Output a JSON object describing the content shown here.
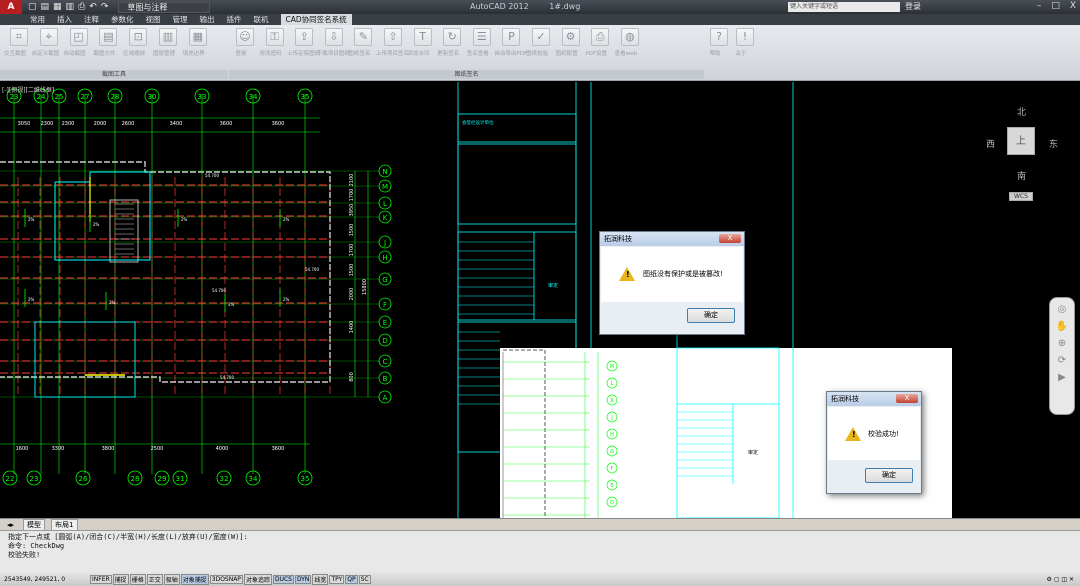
{
  "titlebar": {
    "app_icon": "A",
    "workspace": "草图与注释",
    "app_name": "AutoCAD 2012",
    "file_name": "1#.dwg",
    "search_placeholder": "键入关键字或短语",
    "login_label": "登录",
    "minimize_label": "–",
    "maximize_label": "□",
    "close_label": "X"
  },
  "menu": {
    "items": [
      "常用",
      "插入",
      "注释",
      "参数化",
      "视图",
      "管理",
      "输出",
      "插件",
      "联机",
      "CAD协同签名系统"
    ],
    "active_index": 9
  },
  "ribbon": {
    "tools": [
      {
        "label": "交互截图",
        "icon": "crop-icon"
      },
      {
        "label": "自定义截图",
        "icon": "crop-custom-icon"
      },
      {
        "label": "自动截图",
        "icon": "auto-crop-icon"
      },
      {
        "label": "截图文件",
        "icon": "file-icon"
      },
      {
        "label": "区域缩放",
        "icon": "zoom-icon"
      },
      {
        "label": "图层管理",
        "icon": "layers-icon"
      },
      {
        "label": "填充边界",
        "icon": "hatch-icon"
      },
      {
        "label": "登录",
        "icon": "user-icon"
      },
      {
        "label": "修改密码",
        "icon": "key-icon"
      },
      {
        "label": "上传定稿图纸",
        "icon": "upload-icon"
      },
      {
        "label": "下载项目图纸",
        "icon": "download-icon"
      },
      {
        "label": "图纸签名",
        "icon": "sign-icon"
      },
      {
        "label": "上传项目签名",
        "icon": "upload-sign-icon"
      },
      {
        "label": "添加水印",
        "icon": "watermark-icon"
      },
      {
        "label": "更新签名",
        "icon": "refresh-icon"
      },
      {
        "label": "签名查看",
        "icon": "view-sign-icon"
      },
      {
        "label": "自动导出PDF",
        "icon": "pdf-icon"
      },
      {
        "label": "图纸校验",
        "icon": "check-icon"
      },
      {
        "label": "图纸配置",
        "icon": "config-icon"
      },
      {
        "label": "PDF设置",
        "icon": "printer-icon"
      },
      {
        "label": "查看web",
        "icon": "web-icon"
      },
      {
        "label": "帮助",
        "icon": "help-icon"
      },
      {
        "label": "关于",
        "icon": "about-icon"
      }
    ],
    "panels": [
      "截图工具",
      "图纸签名"
    ]
  },
  "viewport": {
    "label": "[-][俯视][二维线框]",
    "compass": {
      "north": "北",
      "south": "南",
      "east": "东",
      "west": "西",
      "center": "上",
      "ucs": "WCS"
    },
    "top_axes": [
      "23",
      "24",
      "25",
      "27",
      "28",
      "30",
      "33",
      "34",
      "35"
    ],
    "top_dims": [
      "3050",
      "2300",
      "2300",
      "2000",
      "2600",
      "3400",
      "3600",
      "3600"
    ],
    "bottom_axes": [
      "22",
      "23",
      "26",
      "28",
      "29",
      "31",
      "32",
      "34",
      "35"
    ],
    "bottom_dims": [
      "1600",
      "3300",
      "3800",
      "2500",
      "4000",
      "3600"
    ],
    "right_axes": [
      "N",
      "M",
      "L",
      "K",
      "J",
      "H",
      "G",
      "F",
      "E",
      "D",
      "C",
      "B",
      "A"
    ],
    "right_dims": [
      "2100",
      "1700",
      "3950",
      "1500",
      "1700",
      "1500",
      "2000",
      "1400",
      "800"
    ],
    "overall_dim": "15800",
    "room_dims": [
      "54.700",
      "54.700",
      "54.700",
      "54.700",
      "54.700"
    ],
    "slope_label": "2%",
    "title_block_text": "审定",
    "title_block_header": "会签栏设计单位",
    "sheet_label": "结构"
  },
  "dialogs": [
    {
      "title": "拓润科技",
      "message": "图纸没有保护或是被篡改!",
      "ok": "确定",
      "close": "X"
    },
    {
      "title": "拓润科技",
      "message": "校验成功!",
      "ok": "确定",
      "close": "X"
    }
  ],
  "tabs": [
    "模型",
    "布局1"
  ],
  "command": {
    "lines": [
      "指定下一点或 [圆弧(A)/闭合(C)/半宽(H)/长度(L)/放弃(U)/宽度(W)]:",
      "命令: CheckDwg",
      "校验失败!"
    ]
  },
  "status": {
    "coords": "2543549, 249521, 0",
    "toggles": [
      {
        "label": "INFER",
        "on": false
      },
      {
        "label": "捕捉",
        "on": false
      },
      {
        "label": "栅格",
        "on": false
      },
      {
        "label": "正交",
        "on": false
      },
      {
        "label": "极轴",
        "on": false
      },
      {
        "label": "对象捕捉",
        "on": true
      },
      {
        "label": "3DOSNAP",
        "on": false
      },
      {
        "label": "对象追踪",
        "on": false
      },
      {
        "label": "DUCS",
        "on": true
      },
      {
        "label": "DYN",
        "on": true
      },
      {
        "label": "线宽",
        "on": false
      },
      {
        "label": "TPY",
        "on": false
      },
      {
        "label": "QP",
        "on": true
      },
      {
        "label": "SC",
        "on": false
      }
    ]
  },
  "colors": {
    "axis_green": "#00ff00",
    "wall_red": "#ff3b3b",
    "dim_cyan": "#00ffff",
    "grid_white": "#ffffff",
    "highlight_yellow": "#ffff00"
  }
}
